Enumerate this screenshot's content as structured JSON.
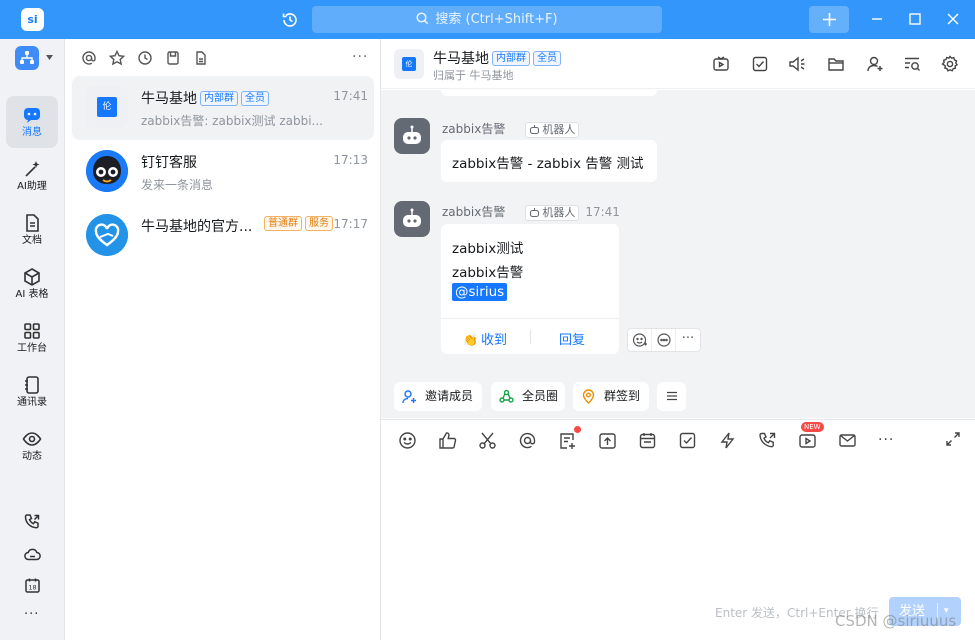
{
  "titlebar": {
    "logo": "si",
    "search_placeholder": "搜索 (Ctrl+Shift+F)"
  },
  "nav": {
    "items": [
      {
        "label": "消息"
      },
      {
        "label": "AI助理"
      },
      {
        "label": "文档"
      },
      {
        "label": "AI 表格"
      },
      {
        "label": "工作台"
      },
      {
        "label": "通讯录"
      },
      {
        "label": "动态"
      }
    ],
    "calendar_day": "18",
    "more": "···"
  },
  "conversations": {
    "more": "···",
    "items": [
      {
        "name": "牛马基地",
        "tags": [
          "内部群",
          "全员"
        ],
        "time": "17:41",
        "preview": "zabbix告警: zabbix测试 zabbi...",
        "avatar_text": "伦"
      },
      {
        "name": "钉钉客服",
        "tags": [],
        "time": "17:13",
        "preview": "发来一条消息"
      },
      {
        "name": "牛马基地的官方...",
        "tags": [
          "普通群",
          "服务"
        ],
        "time": "17:17",
        "preview": ""
      }
    ]
  },
  "chat": {
    "title": "牛马基地",
    "tags": [
      "内部群",
      "全员"
    ],
    "subtitle": "归属于 牛马基地",
    "avatar_text": "伦",
    "messages": [
      {
        "sender": "zabbix告警",
        "badge": "机器人",
        "time": "",
        "text": "zabbix告警 - zabbix 告警 测试"
      },
      {
        "sender": "zabbix告警",
        "badge": "机器人",
        "time": "17:41",
        "lines": [
          "zabbix测试",
          "zabbix告警"
        ],
        "mention": "@sirius",
        "actions": [
          "收到",
          "回复"
        ]
      }
    ],
    "actions_more": "···",
    "quick": [
      {
        "label": "邀请成员"
      },
      {
        "label": "全员圈"
      },
      {
        "label": "群签到"
      }
    ],
    "toolbar_more": "···",
    "new_badge": "NEW",
    "input_hint": "Enter 发送，Ctrl+Enter 换行",
    "send_label": "发送",
    "send_caret": "▾"
  },
  "watermark": "CSDN @siriuuus",
  "colors": {
    "brand": "#3296fa",
    "accent": "#1677ff",
    "bot_avatar": "#646a73"
  }
}
